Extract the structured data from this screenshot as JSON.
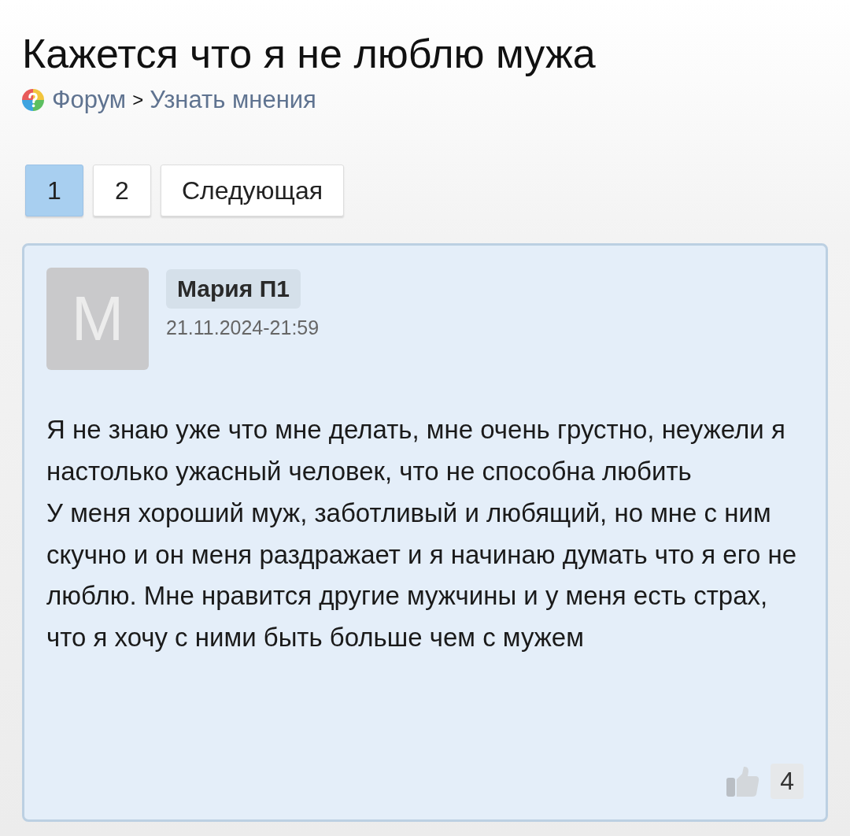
{
  "title": "Кажется что я не люблю мужа",
  "breadcrumb": {
    "items": [
      "Форум",
      "Узнать мнения"
    ],
    "separator": ">"
  },
  "pagination": [
    {
      "label": "1",
      "selected": true
    },
    {
      "label": "2",
      "selected": false
    },
    {
      "label": "Следующая",
      "selected": false
    }
  ],
  "post": {
    "avatar_letter": "М",
    "author": "Мария П1",
    "date": "21.11.2024-21:59",
    "paragraphs": [
      "Я не знаю уже что мне делать, мне очень грустно, неужели я настолько ужасный человек, что не способна любить",
      "У меня хороший муж, заботливый и любящий, но мне с ним скучно и он меня раздражает и я начинаю думать что я его не люблю. Мне нравится другие мужчины и у меня есть страх, что я хочу с ними быть больше чем с мужем"
    ],
    "likes": "4"
  }
}
